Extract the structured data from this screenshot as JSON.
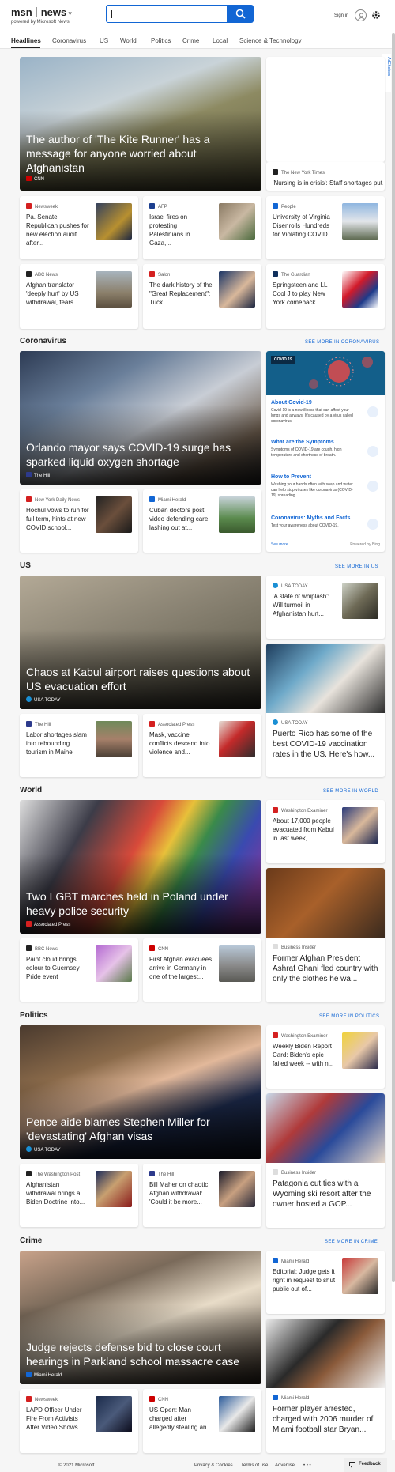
{
  "header": {
    "brand": "msn",
    "section": "news",
    "chevron": "˅",
    "powered_by": "powered by Microsoft News",
    "search_placeholder": "",
    "signin": "Sign in"
  },
  "nav": {
    "items": [
      "Headlines",
      "Coronavirus",
      "US",
      "World",
      "Politics",
      "Crime",
      "Local",
      "Science & Technology"
    ]
  },
  "adchoices": "AdChoices",
  "top": {
    "hero": {
      "title": "The author of 'The Kite Runner' has a message for anyone worried about Afghanistan",
      "source": "CNN"
    },
    "cards": [
      {
        "source": "The New York Times",
        "title": "'Nursing is in crisis': Staff shortages put..."
      },
      {
        "source": "Newsweek",
        "title": "Pa. Senate Republican pushes for new election audit after..."
      },
      {
        "source": "AFP",
        "title": "Israel fires on protesting Palestinians in Gaza,..."
      },
      {
        "source": "People",
        "title": "University of Virginia Disenrolls Hundreds for Violating COVID..."
      },
      {
        "source": "ABC News",
        "title": "Afghan translator 'deeply hurt' by US withdrawal, fears..."
      },
      {
        "source": "Salon",
        "title": "The dark history of the \"Great Replacement\": Tuck..."
      },
      {
        "source": "The Guardian",
        "title": "Springsteen and LL Cool J to play New York comeback..."
      }
    ]
  },
  "coronavirus": {
    "heading": "Coronavirus",
    "more": "SEE MORE IN CORONAVIRUS",
    "hero": {
      "title": "Orlando mayor says COVID-19 surge has sparked liquid oxygen shortage",
      "source": "The Hill"
    },
    "cards": [
      {
        "source": "New York Daily News",
        "title": "Hochul vows to run for full term, hints at new COVID school..."
      },
      {
        "source": "Miami Herald",
        "title": "Cuban doctors post video defending care, lashing out at..."
      }
    ],
    "panel": {
      "badge": "COVID 19",
      "items": [
        {
          "h": "About Covid-19",
          "d": "Covid-19 is a new illness that can affect your lungs and airways. It's caused by a virus called coronavirus."
        },
        {
          "h": "What are the Symptoms",
          "d": "Symptoms of COVID-19 are cough, high temperature and shortness of breath."
        },
        {
          "h": "How to Prevent",
          "d": "Washing your hands often with soap and water can help stop viruses like coronavirus (COVID-19) spreading."
        },
        {
          "h": "Coronavirus: Myths and Facts",
          "d": "Test your awareness about COVID-19."
        }
      ],
      "see_more": "See more",
      "powered": "Powered by Bing"
    }
  },
  "us": {
    "heading": "US",
    "more": "SEE MORE IN US",
    "hero": {
      "title": "Chaos at Kabul airport raises questions about US evacuation effort",
      "source": "USA TODAY"
    },
    "side": {
      "source": "USA TODAY",
      "title": "'A state of whiplash': Will turmoil in Afghanistan hurt..."
    },
    "tall": {
      "source": "USA TODAY",
      "title": "Puerto Rico has some of the best COVID-19 vaccination rates in the US. Here's how..."
    },
    "cards": [
      {
        "source": "The Hill",
        "title": "Labor shortages slam into rebounding tourism in Maine"
      },
      {
        "source": "Associated Press",
        "title": "Mask, vaccine conflicts descend into violence and..."
      }
    ]
  },
  "world": {
    "heading": "World",
    "more": "SEE MORE IN WORLD",
    "hero": {
      "title": "Two LGBT marches held in Poland under heavy police security",
      "source": "Associated Press"
    },
    "side": {
      "source": "Washington Examiner",
      "title": "About 17,000 people evacuated from Kabul in last week,..."
    },
    "tall": {
      "source": "Business Insider",
      "title": "Former Afghan President Ashraf Ghani fled country with only the clothes he wa..."
    },
    "cards": [
      {
        "source": "BBC News",
        "title": "Paint cloud brings colour to Guernsey Pride event"
      },
      {
        "source": "CNN",
        "title": "First Afghan evacuees arrive in Germany in one of the largest..."
      }
    ]
  },
  "politics": {
    "heading": "Politics",
    "more": "SEE MORE IN POLITICS",
    "hero": {
      "title": "Pence aide blames Stephen Miller for 'devastating' Afghan visas",
      "source": "USA TODAY"
    },
    "side": {
      "source": "Washington Examiner",
      "title": "Weekly Biden Report Card: Biden's epic failed week -- with n..."
    },
    "tall": {
      "source": "Business Insider",
      "title": "Patagonia cut ties with a Wyoming ski resort after the owner hosted a GOP..."
    },
    "cards": [
      {
        "source": "The Washington Post",
        "title": "Afghanistan withdrawal brings a Biden Doctrine into..."
      },
      {
        "source": "The Hill",
        "title": "Bill Maher on chaotic Afghan withdrawal: 'Could it be more..."
      }
    ]
  },
  "crime": {
    "heading": "Crime",
    "more": "SEE MORE IN CRIME",
    "hero": {
      "title": "Judge rejects defense bid to close court hearings in Parkland school massacre case",
      "source": "Miami Herald"
    },
    "side": {
      "source": "Miami Herald",
      "title": "Editorial: Judge gets it right in request to shut public out of..."
    },
    "tall": {
      "source": "Miami Herald",
      "title": "Former player arrested, charged with 2006 murder of Miami football star Bryan..."
    },
    "cards": [
      {
        "source": "Newsweek",
        "title": "LAPD Officer Under Fire From Activists After Video Shows..."
      },
      {
        "source": "CNN",
        "title": "US Open: Man charged after allegedly stealing an..."
      }
    ]
  },
  "footer": {
    "copyright": "© 2021 Microsoft",
    "privacy": "Privacy & Cookies",
    "terms": "Terms of use",
    "advertise": "Advertise",
    "more": "• • •",
    "feedback": "Feedback"
  },
  "colors": {
    "accent": "#1266d4",
    "cnn": "#cc0000"
  }
}
